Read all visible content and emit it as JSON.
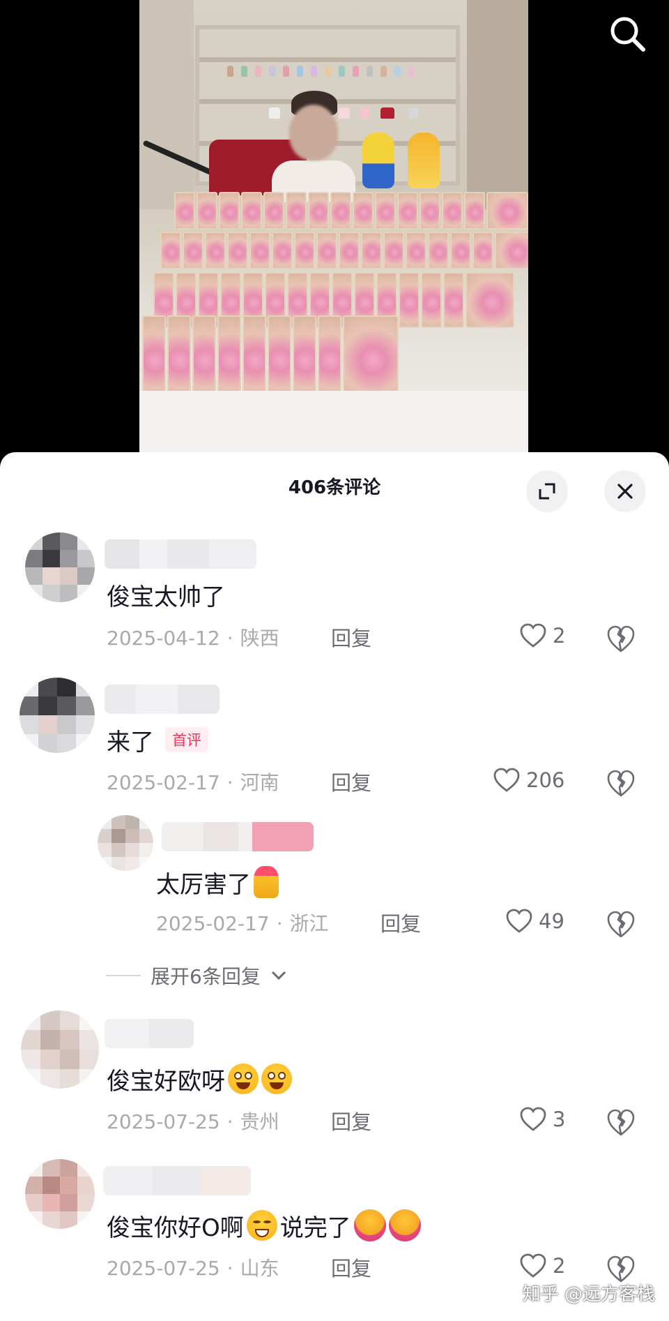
{
  "header": {
    "title": "406条评论"
  },
  "comments": [
    {
      "text": "俊宝太帅了",
      "badge": "",
      "date": "2025-04-12",
      "location": "陕西",
      "reply_label": "回复",
      "likes": "2"
    },
    {
      "text": "来了",
      "badge": "首评",
      "date": "2025-02-17",
      "location": "河南",
      "reply_label": "回复",
      "likes": "206"
    },
    {
      "text": "太厉害了",
      "badge": "",
      "date": "2025-02-17",
      "location": "浙江",
      "reply_label": "回复",
      "likes": "49"
    },
    {
      "text": "俊宝好欧呀",
      "badge": "",
      "date": "2025-07-25",
      "location": "贵州",
      "reply_label": "回复",
      "likes": "3"
    },
    {
      "text": "俊宝你好O啊",
      "text2": "说完了",
      "badge": "",
      "date": "2025-07-25",
      "location": "山东",
      "reply_label": "回复",
      "likes": "2"
    }
  ],
  "expand_replies": "展开6条回复",
  "separator": "·",
  "watermark": "知乎 @远方客栈",
  "icons": [
    "search-icon",
    "expand-icon",
    "close-icon",
    "heart-icon",
    "broken-heart-icon",
    "chevron-down-icon"
  ],
  "colors": {
    "badge_text": "#fe2c55",
    "badge_bg": "#ffeef1",
    "meta_text": "#a8a9ad",
    "action_text": "#6b6c72"
  }
}
